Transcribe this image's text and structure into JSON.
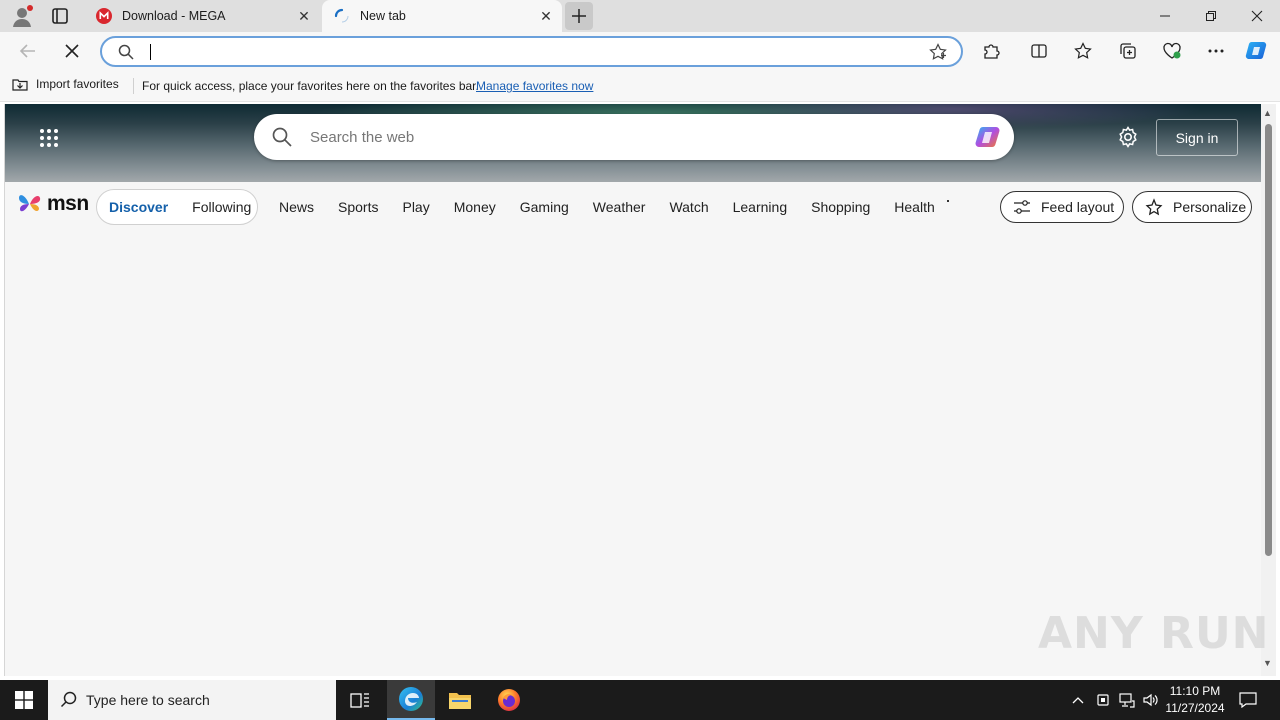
{
  "tabs": [
    {
      "title": "Download - MEGA",
      "favicon": "mega-icon",
      "active": false
    },
    {
      "title": "New tab",
      "favicon": "loading-icon",
      "active": true
    }
  ],
  "omnibox": {
    "value": "",
    "placeholder": ""
  },
  "favorites_bar": {
    "import_label": "Import favorites",
    "hint": "For quick access, place your favorites here on the favorites bar.",
    "manage_link": "Manage favorites now"
  },
  "msn": {
    "search_placeholder": "Search the web",
    "signin_label": "Sign in",
    "logo_text": "msn",
    "tabs": {
      "discover": "Discover",
      "following": "Following"
    },
    "nav": [
      "News",
      "Sports",
      "Play",
      "Money",
      "Gaming",
      "Weather",
      "Watch",
      "Learning",
      "Shopping",
      "Health"
    ],
    "feed_layout_label": "Feed layout",
    "personalize_label": "Personalize"
  },
  "watermark": "ANY RUN",
  "taskbar": {
    "search_placeholder": "Type here to search",
    "time": "11:10 PM",
    "date": "11/27/2024"
  },
  "colors": {
    "accent": "#1460aa",
    "omnibox_border": "#6aa0db",
    "taskbar": "#1b1b1b"
  }
}
